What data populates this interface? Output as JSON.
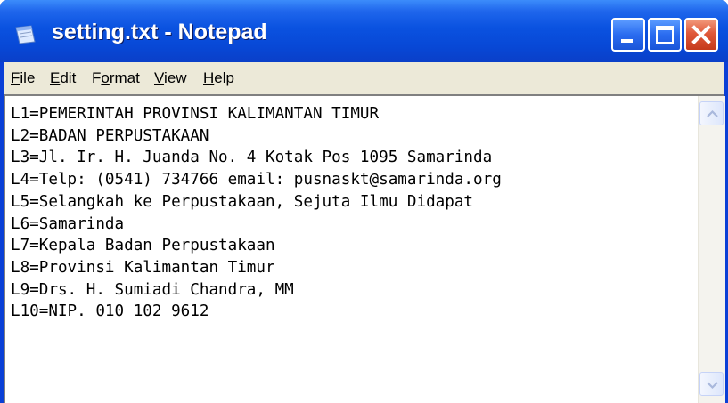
{
  "window": {
    "title": "setting.txt - Notepad",
    "icon": "notepad-icon"
  },
  "caption_buttons": {
    "minimize_icon": "minimize-icon",
    "maximize_icon": "maximize-icon",
    "close_icon": "close-icon"
  },
  "menu": [
    {
      "pre": "",
      "key": "F",
      "post": "ile"
    },
    {
      "pre": "",
      "key": "E",
      "post": "dit"
    },
    {
      "pre": "F",
      "key": "o",
      "post": "rmat"
    },
    {
      "pre": "",
      "key": "V",
      "post": "iew"
    },
    {
      "pre": "",
      "key": "H",
      "post": "elp"
    }
  ],
  "document": {
    "lines": [
      "L1=PEMERINTAH PROVINSI KALIMANTAN TIMUR",
      "L2=BADAN PERPUSTAKAAN",
      "L3=Jl. Ir. H. Juanda No. 4 Kotak Pos 1095 Samarinda",
      "L4=Telp: (0541) 734766 email: pusnaskt@samarinda.org",
      "L5=Selangkah ke Perpustakaan, Sejuta Ilmu Didapat",
      "L6=Samarinda",
      "L7=Kepala Badan Perpustakaan",
      "L8=Provinsi Kalimantan Timur",
      "L9=Drs. H. Sumiadi Chandra, MM",
      "L10=NIP. 010 102 9612"
    ]
  },
  "colors": {
    "titlebar": "#0a52e0",
    "menubar": "#ece9d8",
    "close_button": "#e0593a"
  }
}
